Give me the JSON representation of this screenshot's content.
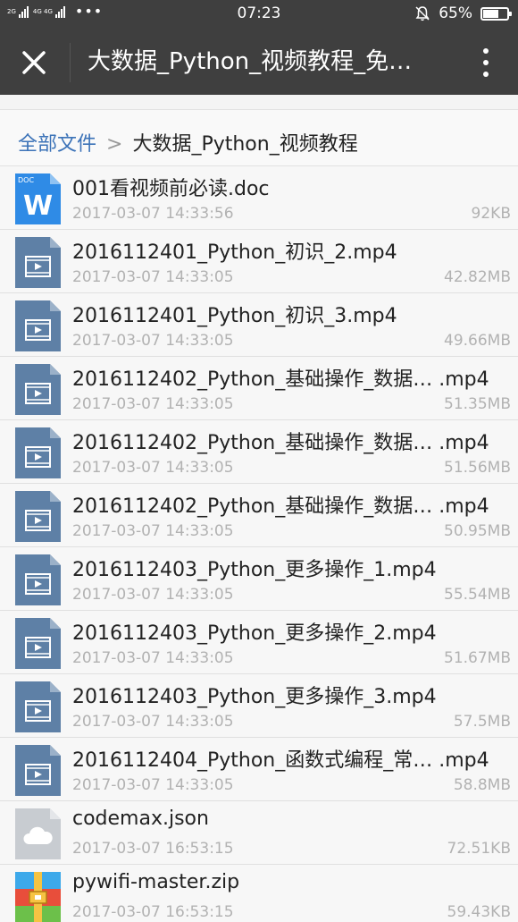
{
  "status_bar": {
    "network_label_1": "2G",
    "network_label_2": "4G 4G",
    "more_indicator": "•••",
    "time": "07:23",
    "battery_percent": "65%",
    "battery_level": 0.65
  },
  "app_bar": {
    "title": "大数据_Python_视频教程_免…"
  },
  "breadcrumb": {
    "root": "全部文件",
    "separator": ">",
    "current": "大数据_Python_视频教程"
  },
  "files": [
    {
      "name": "001看视频前必读.doc",
      "date": "2017-03-07 14:33:56",
      "size": "92KB",
      "type": "doc"
    },
    {
      "name": "2016112401_Python_初识_2.mp4",
      "date": "2017-03-07 14:33:05",
      "size": "42.82MB",
      "type": "video"
    },
    {
      "name": "2016112401_Python_初识_3.mp4",
      "date": "2017-03-07 14:33:05",
      "size": "49.66MB",
      "type": "video"
    },
    {
      "name": "2016112402_Python_基础操作_数据… .mp4",
      "date": "2017-03-07 14:33:05",
      "size": "51.35MB",
      "type": "video"
    },
    {
      "name": "2016112402_Python_基础操作_数据… .mp4",
      "date": "2017-03-07 14:33:05",
      "size": "51.56MB",
      "type": "video"
    },
    {
      "name": "2016112402_Python_基础操作_数据… .mp4",
      "date": "2017-03-07 14:33:05",
      "size": "50.95MB",
      "type": "video"
    },
    {
      "name": "2016112403_Python_更多操作_1.mp4",
      "date": "2017-03-07 14:33:05",
      "size": "55.54MB",
      "type": "video"
    },
    {
      "name": "2016112403_Python_更多操作_2.mp4",
      "date": "2017-03-07 14:33:05",
      "size": "51.67MB",
      "type": "video"
    },
    {
      "name": "2016112403_Python_更多操作_3.mp4",
      "date": "2017-03-07 14:33:05",
      "size": "57.5MB",
      "type": "video"
    },
    {
      "name": "2016112404_Python_函数式编程_常… .mp4",
      "date": "2017-03-07 14:33:05",
      "size": "58.8MB",
      "type": "video"
    },
    {
      "name": "codemax.json",
      "date": "2017-03-07 16:53:15",
      "size": "72.51KB",
      "type": "cloud"
    },
    {
      "name": "pywifi-master.zip",
      "date": "2017-03-07 16:53:15",
      "size": "59.43KB",
      "type": "zip"
    }
  ],
  "icons": {
    "doc": "word-doc-icon",
    "doc_tag": "DOC",
    "doc_letter": "W",
    "video": "video-file-icon",
    "cloud": "cloud-file-icon",
    "zip": "zip-archive-icon"
  },
  "colors": {
    "app_bar": "#3f3f3f",
    "breadcrumb_link": "#3c73b8",
    "doc_icon": "#2f8be6",
    "video_icon": "#5e80a6",
    "cloud_icon": "#c8ccd1"
  }
}
